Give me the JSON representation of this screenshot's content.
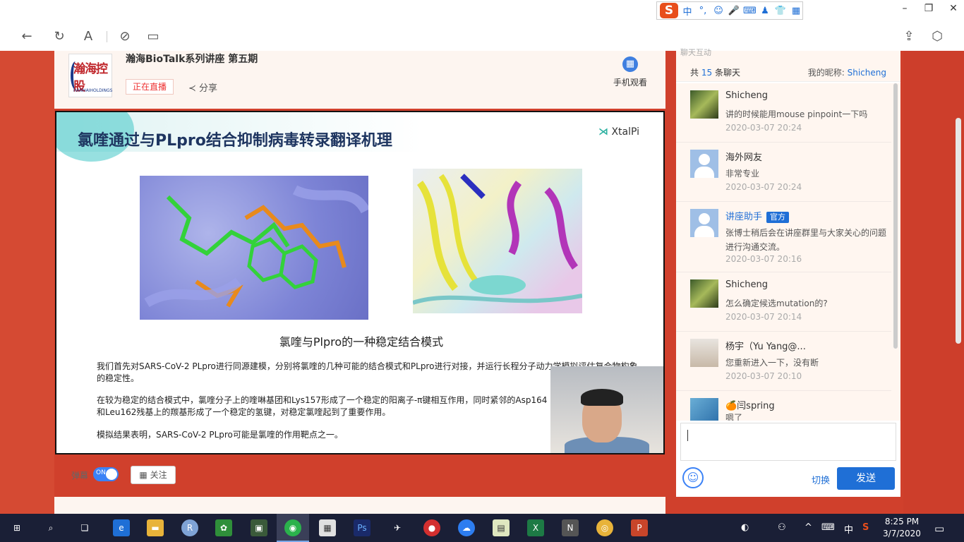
{
  "ime": {
    "logo": "S",
    "lang": "中",
    "punct": "°,",
    "emoji_icon": "smile-icon",
    "mic_icon": "mic-icon",
    "keyboard_icon": "keyboard-icon",
    "skin_icon": "skin-icon",
    "grid_icon": "grid-icon"
  },
  "window": {
    "minimize": "–",
    "restore": "❐",
    "close": "✕"
  },
  "nav": {
    "back": "←",
    "refresh": "↻",
    "reader": "A",
    "link": "⊘",
    "tab": "▭",
    "share": "⇪",
    "ext": "⬡"
  },
  "card": {
    "logo_text": "瀚海控股",
    "logo_sub": "HANHAIHOLDINGS",
    "title": "瀚海BioTalk系列讲座 第五期",
    "live_badge": "正在直播",
    "share_label": "分享",
    "phone_label": "手机观看"
  },
  "slide": {
    "title": "氯喹通过与PLpro结合抑制病毒转录翻译机理",
    "brand_prefix": "⋊",
    "brand": "XtalPi",
    "caption": "氯喹与Plpro的一种稳定结合模式",
    "p1": "我们首先对SARS-CoV-2 PLpro进行同源建模，分别将氯喹的几种可能的结合模式和PLpro进行对接，并运行长程分子动力学模拟评估复合物构象的稳定性。",
    "p2": "在较为稳定的结合模式中，氯喹分子上的喹啉基团和Lys157形成了一个稳定的阳离子-π键相互作用，同时紧邻的Asp164和Leu162残基上的羰基形成了一个稳定的氢键，对稳定氯喹起到了重要作用。",
    "p3": "模拟结果表明，SARS-CoV-2 PLpro可能是氯喹的作用靶点之一。"
  },
  "controls": {
    "danmu": "弹幕",
    "toggle": "ON",
    "follow": "关注"
  },
  "chat": {
    "header_partial": "聊天互动",
    "total_prefix": "共",
    "total_count": "15",
    "total_suffix": "条聊天",
    "nickname_label": "我的昵称:",
    "nickname": "Shicheng",
    "messages": [
      {
        "name": "Shicheng",
        "text": "讲的时候能用mouse pinpoint一下吗",
        "time": "2020-03-07 20:24"
      },
      {
        "name": "海外网友",
        "text": "非常专业",
        "time": "2020-03-07 20:24"
      },
      {
        "name": "讲座助手",
        "tag": "官方",
        "text": "张博士稍后会在讲座群里与大家关心的问题进行沟通交流。",
        "time": "2020-03-07 20:16"
      },
      {
        "name": "Shicheng",
        "text": "怎么确定候选mutation的?",
        "time": "2020-03-07 20:14"
      },
      {
        "name": "杨宇（Yu Yang@...",
        "text": "您重新进入一下，没有断",
        "time": "2020-03-07 20:10"
      },
      {
        "name": "🍊闫spring",
        "text": "嗯了",
        "time": ""
      }
    ],
    "switch_label": "切换",
    "send_label": "发送"
  },
  "taskbar": {
    "time": "8:25 PM",
    "date": "3/7/2020",
    "ime": "中",
    "apps": [
      "start-icon",
      "search-icon",
      "taskview-icon",
      "edge-icon",
      "explorer-icon",
      "r-icon",
      "app-green-icon",
      "app-lock-icon",
      "wechat-icon",
      "store-icon",
      "photoshop-icon",
      "app-bird-icon",
      "app-red-icon",
      "baidu-icon",
      "app-chart-icon",
      "excel-icon",
      "nih-icon",
      "chrome-icon",
      "powerpoint-icon"
    ]
  },
  "colors": {
    "accent": "#1f6fd6",
    "page_red": "#d0402c",
    "live_red": "#e33333",
    "taskbar": "#1a1f36"
  }
}
